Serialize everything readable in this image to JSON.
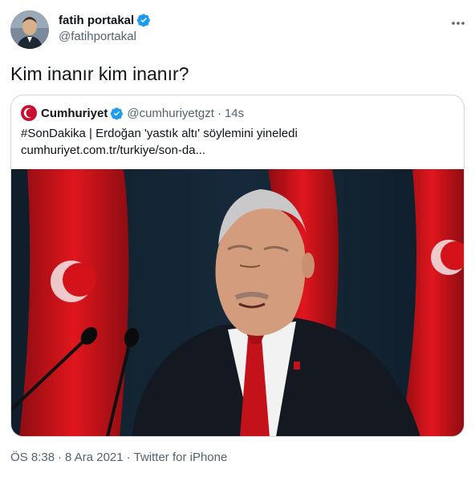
{
  "author": {
    "display_name": "fatih portakal",
    "handle": "@fatihportakal",
    "avatar_icon": "user-avatar-icon",
    "verified_icon": "verified-badge-icon",
    "more_icon": "more-options-icon"
  },
  "tweet": {
    "text": "Kim inanır kim inanır?"
  },
  "quoted_tweet": {
    "logo_icon": "cumhuriyet-logo-icon",
    "display_name": "Cumhuriyet",
    "handle": "@cumhuriyetgzt",
    "separator": "·",
    "time": "14s",
    "text": "#SonDakika | Erdoğan 'yastık altı' söylemini yineledi",
    "link": "cumhuriyet.com.tr/turkiye/son-da..."
  },
  "meta": {
    "time": "ÖS 8:38",
    "separator_1": "·",
    "date": "8 Ara 2021",
    "separator_2": "·",
    "source": "Twitter for iPhone"
  },
  "colors": {
    "text": "#0f1419",
    "secondary": "#536471",
    "verified_blue": "#1d9bf0",
    "border": "#cfd9de",
    "flag_red": "#d3121a",
    "logo_red": "#c8102e"
  }
}
